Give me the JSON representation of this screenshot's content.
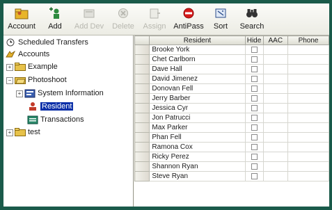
{
  "toolbar": {
    "buttons": [
      {
        "label": "Account",
        "icon": "account-folder-icon"
      },
      {
        "label": "Add",
        "icon": "add-person-icon"
      },
      {
        "label": "Add Dev",
        "icon": "add-device-icon"
      },
      {
        "label": "Delete",
        "icon": "delete-icon"
      },
      {
        "label": "Assign",
        "icon": "assign-icon"
      },
      {
        "label": "AntiPass",
        "icon": "antipass-icon"
      },
      {
        "label": "Sort",
        "icon": "sort-icon"
      },
      {
        "label": "Search",
        "icon": "binoculars-icon"
      }
    ]
  },
  "tree": {
    "scheduled": "Scheduled Transfers",
    "accounts": "Accounts",
    "example": "Example",
    "photoshoot": "Photoshoot",
    "system_info": "System Information",
    "resident": "Resident",
    "transactions": "Transactions",
    "test": "test"
  },
  "grid": {
    "columns": [
      "",
      "Resident",
      "Hide",
      "AAC",
      "Phone"
    ],
    "rows": [
      "Brooke York",
      "Chet Carlborn",
      "Dave Hall",
      "David Jimenez",
      "Donovan Fell",
      "Jerry Barber",
      "Jessica Cyr",
      "Jon Patrucci",
      "Max Parker",
      "Phan Fell",
      "Ramona Cox",
      "Ricky Perez",
      "Shannon Ryan",
      "Steve Ryan"
    ]
  },
  "colors": {
    "frame": "#1a5a4a",
    "selection": "#0a2fa8",
    "antipass_red": "#d61a1a"
  }
}
